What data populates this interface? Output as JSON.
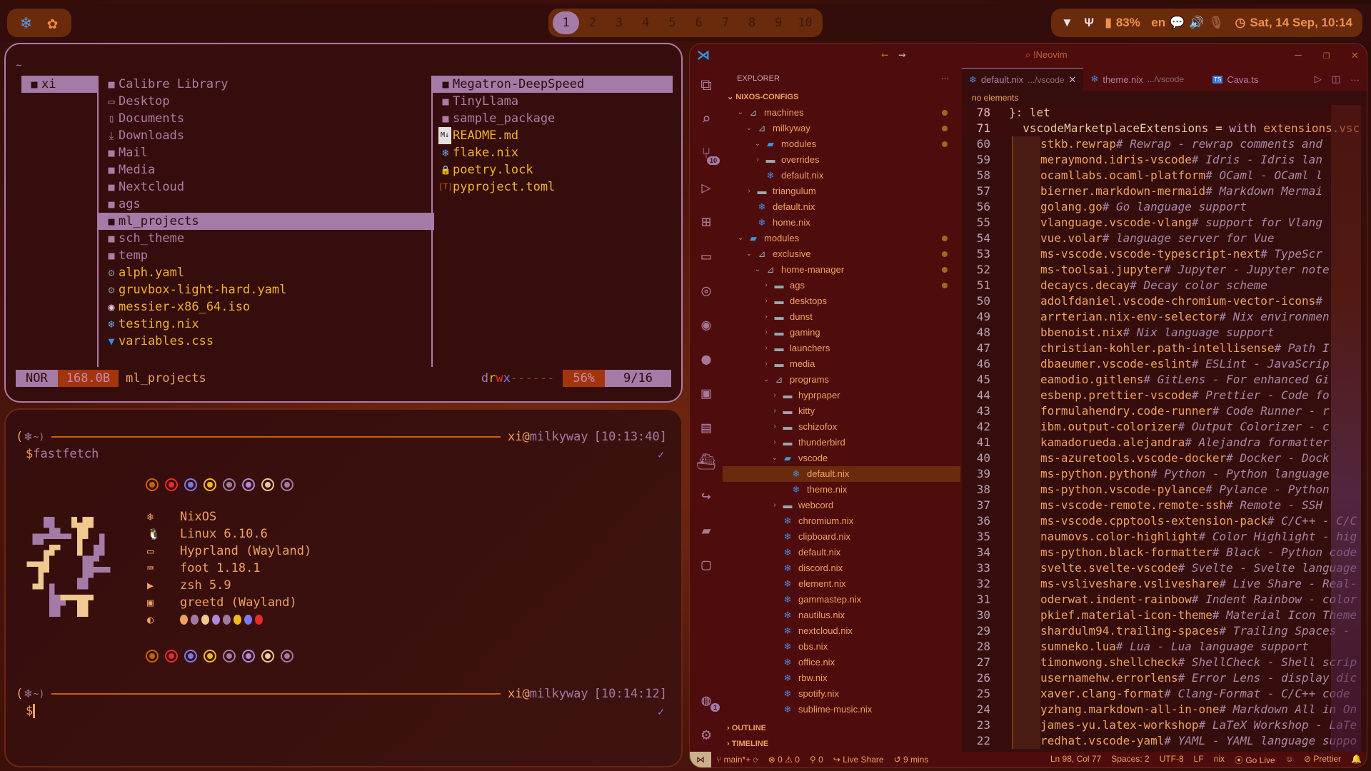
{
  "topbar": {
    "left_icons": [
      "nixos-snowflake-icon",
      "openai-icon"
    ],
    "workspaces": [
      "1",
      "2",
      "3",
      "4",
      "5",
      "6",
      "7",
      "8",
      "9",
      "10"
    ],
    "active_workspace": "1",
    "tray": {
      "battery": "83%",
      "language": "en",
      "clock": "Sat, 14 Sep, 10:14"
    }
  },
  "yazi": {
    "cwd": "~",
    "parent": [
      {
        "name": "xi",
        "icon": "folder",
        "selected": true
      }
    ],
    "current": [
      {
        "name": "Calibre Library",
        "icon": "folder"
      },
      {
        "name": "Desktop",
        "icon": "desktop"
      },
      {
        "name": "Documents",
        "icon": "documents"
      },
      {
        "name": "Downloads",
        "icon": "downloads"
      },
      {
        "name": "Mail",
        "icon": "folder"
      },
      {
        "name": "Media",
        "icon": "folder"
      },
      {
        "name": "Nextcloud",
        "icon": "folder"
      },
      {
        "name": "ags",
        "icon": "folder"
      },
      {
        "name": "ml_projects",
        "icon": "folder",
        "selected": true
      },
      {
        "name": "sch_theme",
        "icon": "folder"
      },
      {
        "name": "temp",
        "icon": "folder"
      },
      {
        "name": "alph.yaml",
        "icon": "gear",
        "file": true
      },
      {
        "name": "gruvbox-light-hard.yaml",
        "icon": "gear",
        "file": true
      },
      {
        "name": "messier-x86_64.iso",
        "icon": "disc",
        "file": true
      },
      {
        "name": "testing.nix",
        "icon": "nix",
        "file": true
      },
      {
        "name": "variables.css",
        "icon": "css",
        "file": true
      }
    ],
    "preview": [
      {
        "name": "Megatron-DeepSpeed",
        "icon": "folder",
        "selected": true
      },
      {
        "name": "TinyLlama",
        "icon": "folder"
      },
      {
        "name": "sample_package",
        "icon": "folder"
      },
      {
        "name": "README.md",
        "icon": "markdown",
        "file": true
      },
      {
        "name": "flake.nix",
        "icon": "nix",
        "file": true
      },
      {
        "name": "poetry.lock",
        "icon": "lock",
        "file": true
      },
      {
        "name": "pyproject.toml",
        "icon": "toml",
        "file": true
      }
    ],
    "status": {
      "mode": "NOR",
      "size": "168.0B",
      "name": "ml_projects",
      "perm": [
        "d",
        "r",
        "w",
        "x",
        "------"
      ],
      "percent": "56%",
      "position": "9/16"
    }
  },
  "terminal": {
    "prompt1": {
      "open": "(",
      "tilde": "~)",
      "user": "xi",
      "at": "@",
      "host": "milkyway",
      "time": "[10:13:40]",
      "dollar": "$",
      "command": "fastfetch",
      "check": "✓"
    },
    "prompt2": {
      "open": "(",
      "tilde": "~)",
      "user": "xi",
      "at": "@",
      "host": "milkyway",
      "time": "[10:14:12]",
      "dollar": "$",
      "check": "✓"
    },
    "fastfetch": [
      {
        "icon": "nixos-icon",
        "glyph": "❄",
        "value": "NixOS"
      },
      {
        "icon": "linux-icon",
        "glyph": "🐧",
        "value": "Linux 6.10.6"
      },
      {
        "icon": "window-icon",
        "glyph": "▭",
        "value": "Hyprland (Wayland)"
      },
      {
        "icon": "terminal-icon",
        "glyph": "⌨",
        "value": "foot 1.18.1"
      },
      {
        "icon": "shell-icon",
        "glyph": "▶",
        "value": "zsh 5.9"
      },
      {
        "icon": "monitor-icon",
        "glyph": "▣",
        "value": "greetd (Wayland)"
      }
    ],
    "ring_colors": [
      "#c8600c",
      "#e82a2a",
      "#7a7ae8",
      "#f0b820",
      "#a07aa0",
      "#b08ad8",
      "#f0c890",
      "#a07aa0"
    ],
    "palette_colors": [
      "#f0a060",
      "#a07aa0",
      "#f0c890",
      "#b08ad8",
      "#a07aa0",
      "#f0b820",
      "#7a7ae8",
      "#e82a2a"
    ]
  },
  "vscode": {
    "search": "!Neovim",
    "explorer_title": "EXPLORER",
    "root": "NIXOS-CONFIGS",
    "tree": [
      {
        "name": "machines",
        "depth": 1,
        "kind": "folder-open",
        "chev": "v",
        "modified": true
      },
      {
        "name": "milkyway",
        "depth": 2,
        "kind": "folder-open",
        "chev": "v",
        "modified": true
      },
      {
        "name": "modules",
        "depth": 3,
        "kind": "special-open",
        "chev": "v",
        "modified": true
      },
      {
        "name": "overrides",
        "depth": 3,
        "kind": "folder",
        "chev": ">"
      },
      {
        "name": "default.nix",
        "depth": 3,
        "kind": "nix"
      },
      {
        "name": "triangulum",
        "depth": 2,
        "kind": "folder",
        "chev": ">"
      },
      {
        "name": "default.nix",
        "depth": 2,
        "kind": "nix"
      },
      {
        "name": "home.nix",
        "depth": 2,
        "kind": "nix"
      },
      {
        "name": "modules",
        "depth": 1,
        "kind": "special-open",
        "chev": "v",
        "modified": true
      },
      {
        "name": "exclusive",
        "depth": 2,
        "kind": "folder-open",
        "chev": "v",
        "modified": true
      },
      {
        "name": "home-manager",
        "depth": 3,
        "kind": "folder-open",
        "chev": "v",
        "modified": true
      },
      {
        "name": "ags",
        "depth": 4,
        "kind": "folder",
        "chev": ">",
        "modified": true
      },
      {
        "name": "desktops",
        "depth": 4,
        "kind": "folder",
        "chev": ">"
      },
      {
        "name": "dunst",
        "depth": 4,
        "kind": "folder",
        "chev": ">"
      },
      {
        "name": "gaming",
        "depth": 4,
        "kind": "folder",
        "chev": ">"
      },
      {
        "name": "launchers",
        "depth": 4,
        "kind": "folder",
        "chev": ">"
      },
      {
        "name": "media",
        "depth": 4,
        "kind": "folder",
        "chev": ">"
      },
      {
        "name": "programs",
        "depth": 4,
        "kind": "folder-open",
        "chev": "v"
      },
      {
        "name": "hyprpaper",
        "depth": 5,
        "kind": "folder",
        "chev": ">"
      },
      {
        "name": "kitty",
        "depth": 5,
        "kind": "folder",
        "chev": ">"
      },
      {
        "name": "schizofox",
        "depth": 5,
        "kind": "folder",
        "chev": ">"
      },
      {
        "name": "thunderbird",
        "depth": 5,
        "kind": "folder",
        "chev": ">"
      },
      {
        "name": "vscode",
        "depth": 5,
        "kind": "special-open",
        "chev": "v"
      },
      {
        "name": "default.nix",
        "depth": 6,
        "kind": "nix",
        "selected": true
      },
      {
        "name": "theme.nix",
        "depth": 6,
        "kind": "nix"
      },
      {
        "name": "webcord",
        "depth": 5,
        "kind": "folder",
        "chev": ">"
      },
      {
        "name": "chromium.nix",
        "depth": 5,
        "kind": "nix"
      },
      {
        "name": "clipboard.nix",
        "depth": 5,
        "kind": "nix"
      },
      {
        "name": "default.nix",
        "depth": 5,
        "kind": "nix"
      },
      {
        "name": "discord.nix",
        "depth": 5,
        "kind": "nix"
      },
      {
        "name": "element.nix",
        "depth": 5,
        "kind": "nix"
      },
      {
        "name": "gammastep.nix",
        "depth": 5,
        "kind": "nix"
      },
      {
        "name": "nautilus.nix",
        "depth": 5,
        "kind": "nix"
      },
      {
        "name": "nextcloud.nix",
        "depth": 5,
        "kind": "nix"
      },
      {
        "name": "obs.nix",
        "depth": 5,
        "kind": "nix"
      },
      {
        "name": "office.nix",
        "depth": 5,
        "kind": "nix"
      },
      {
        "name": "rbw.nix",
        "depth": 5,
        "kind": "nix"
      },
      {
        "name": "spotify.nix",
        "depth": 5,
        "kind": "nix"
      },
      {
        "name": "sublime-music.nix",
        "depth": 5,
        "kind": "nix"
      }
    ],
    "sections": [
      "OUTLINE",
      "TIMELINE"
    ],
    "tabs": [
      {
        "name": "default.nix",
        "path": ".../vscode",
        "active": true,
        "icon": "nix"
      },
      {
        "name": "theme.nix",
        "path": ".../vscode",
        "icon": "nix"
      },
      {
        "name": "Cava.ts",
        "path": "",
        "icon": "ts"
      }
    ],
    "breadcrumb": "no elements",
    "sticky": [
      {
        "ln": "78",
        "code": "}: let"
      },
      {
        "ln": "71",
        "code": "  vscodeMarketplaceExtensions = ",
        "kw": "with",
        "rest": " extensions.vsc"
      }
    ],
    "lines": [
      {
        "ln": "60",
        "code": "stkb.rewrap",
        "comment": "# Rewrap - rewrap comments and"
      },
      {
        "ln": "59",
        "code": "meraymond.idris-vscode",
        "comment": "# Idris - Idris lan"
      },
      {
        "ln": "58",
        "code": "ocamllabs.ocaml-platform",
        "comment": "# OCaml - OCaml l"
      },
      {
        "ln": "57",
        "code": "bierner.markdown-mermaid",
        "comment": "# Markdown Mermai"
      },
      {
        "ln": "56",
        "code": "golang.go",
        "comment": "# Go language support"
      },
      {
        "ln": "55",
        "code": "vlanguage.vscode-vlang",
        "comment": "# support for Vlang"
      },
      {
        "ln": "54",
        "code": "vue.volar",
        "comment": "# language server for Vue"
      },
      {
        "ln": "53",
        "code": "ms-vscode.vscode-typescript-next",
        "comment": "# TypeScr"
      },
      {
        "ln": "52",
        "code": "ms-toolsai.jupyter",
        "comment": "# Jupyter - Jupyter note"
      },
      {
        "ln": "51",
        "code": "decaycs.decay",
        "comment": "# Decay color scheme"
      },
      {
        "ln": "50",
        "code": "adolfdaniel.vscode-chromium-vector-icons",
        "comment": "#"
      },
      {
        "ln": "49",
        "code": "arrterian.nix-env-selector",
        "comment": "# Nix environmen"
      },
      {
        "ln": "48",
        "code": "bbenoist.nix",
        "comment": "# Nix language support"
      },
      {
        "ln": "47",
        "code": "christian-kohler.path-intellisense",
        "comment": "# Path I"
      },
      {
        "ln": "46",
        "code": "dbaeumer.vscode-eslint",
        "comment": "# ESLint - JavaScrip"
      },
      {
        "ln": "45",
        "code": "eamodio.gitlens",
        "comment": "# GitLens - For enhanced Gi"
      },
      {
        "ln": "44",
        "code": "esbenp.prettier-vscode",
        "comment": "# Prettier - Code fo"
      },
      {
        "ln": "43",
        "code": "formulahendry.code-runner",
        "comment": "# Code Runner - r"
      },
      {
        "ln": "42",
        "code": "ibm.output-colorizer",
        "comment": "# Output Colorizer - c"
      },
      {
        "ln": "41",
        "code": "kamadorueda.alejandra",
        "comment": "# Alejandra formatter"
      },
      {
        "ln": "40",
        "code": "ms-azuretools.vscode-docker",
        "comment": "# Docker - Dock"
      },
      {
        "ln": "39",
        "code": "ms-python.python",
        "comment": "# Python - Python language"
      },
      {
        "ln": "38",
        "code": "ms-python.vscode-pylance",
        "comment": "# Pylance - Python"
      },
      {
        "ln": "37",
        "code": "ms-vscode-remote.remote-ssh",
        "comment": "# Remote - SSH"
      },
      {
        "ln": "36",
        "code": "ms-vscode.cpptools-extension-pack",
        "comment": "# C/C++ - C/C"
      },
      {
        "ln": "35",
        "code": "naumovs.color-highlight",
        "comment": "# Color Highlight - hig"
      },
      {
        "ln": "34",
        "code": "ms-python.black-formatter",
        "comment": "# Black - Python code"
      },
      {
        "ln": "33",
        "code": "svelte.svelte-vscode",
        "comment": "# Svelte - Svelte language"
      },
      {
        "ln": "32",
        "code": "ms-vsliveshare.vsliveshare",
        "comment": "# Live Share - Real-"
      },
      {
        "ln": "31",
        "code": "oderwat.indent-rainbow",
        "comment": "# Indent Rainbow - color"
      },
      {
        "ln": "30",
        "code": "pkief.material-icon-theme",
        "comment": "# Material Icon Theme"
      },
      {
        "ln": "29",
        "code": "shardulm94.trailing-spaces",
        "comment": "# Trailing Spaces -"
      },
      {
        "ln": "28",
        "code": "sumneko.lua",
        "comment": "# Lua - Lua language support"
      },
      {
        "ln": "27",
        "code": "timonwong.shellcheck",
        "comment": "# ShellCheck - Shell scrip"
      },
      {
        "ln": "26",
        "code": "usernamehw.errorlens",
        "comment": "# Error Lens - display dic"
      },
      {
        "ln": "25",
        "code": "xaver.clang-format",
        "comment": "# Clang-Format - C/C++ code"
      },
      {
        "ln": "24",
        "code": "yzhang.markdown-all-in-one",
        "comment": "# Markdown All in On"
      },
      {
        "ln": "23",
        "code": "james-yu.latex-workshop",
        "comment": "# LaTeX Workshop - LaTe"
      },
      {
        "ln": "22",
        "code": "redhat.vscode-yaml",
        "comment": "# YAML - YAML language suppo"
      }
    ],
    "activity_badges": {
      "source_control": "10",
      "accounts": "1"
    },
    "status": {
      "branch": "main*+",
      "errors": "0",
      "warnings": "0",
      "ports": "0",
      "live_share": "Live Share",
      "time_tracked": "9 mins",
      "position": "Ln 98, Col 77",
      "spaces": "Spaces: 2",
      "encoding": "UTF-8",
      "eol": "LF",
      "language": "nix",
      "go_live": "Go Live",
      "prettier": "Prettier"
    }
  }
}
